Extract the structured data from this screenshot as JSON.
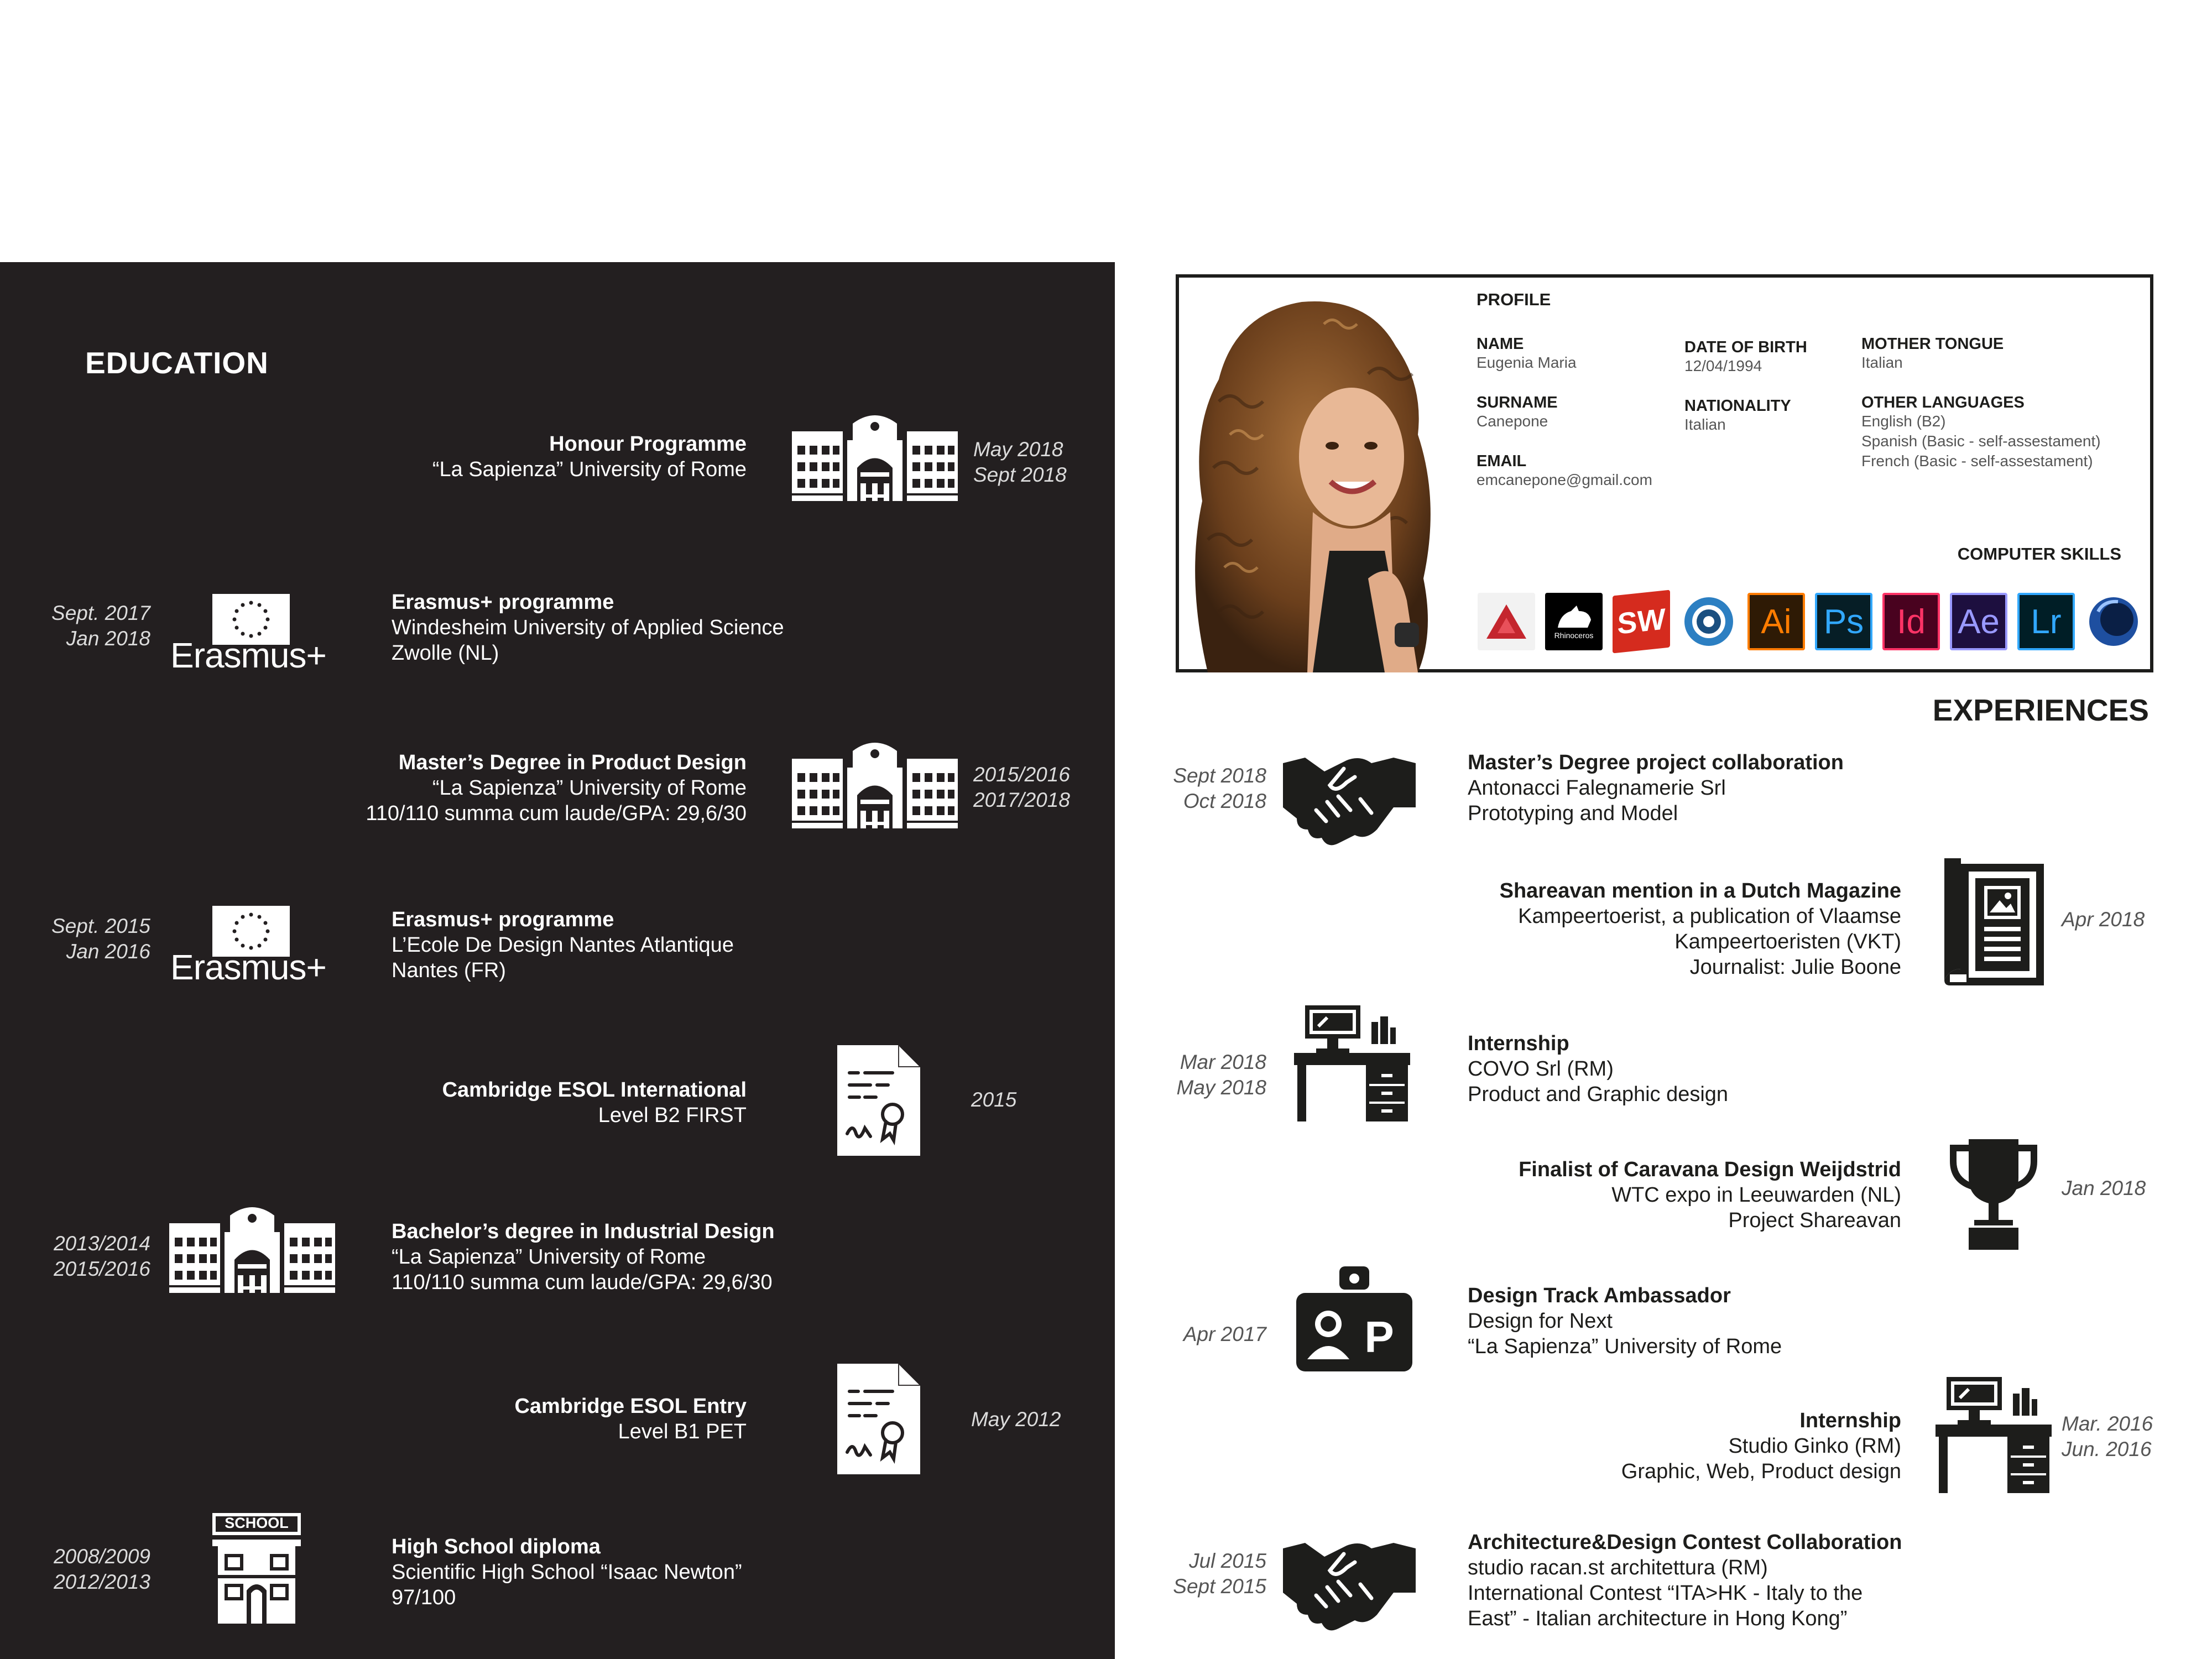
{
  "education": {
    "title": "EDUCATION",
    "items": [
      {
        "title": "Honour Programme",
        "lines": [
          "“La Sapienza” University of Rome"
        ],
        "dates": [
          "May 2018",
          "Sept 2018"
        ]
      },
      {
        "title": "Erasmus+ programme",
        "lines": [
          "Windesheim University of Applied Science",
          "Zwolle (NL)"
        ],
        "dates": [
          "Sept. 2017",
          "Jan 2018"
        ],
        "logo": "Erasmus+"
      },
      {
        "title": "Master’s Degree in Product Design",
        "lines": [
          "“La Sapienza” University of Rome",
          "110/110 summa cum laude/GPA: 29,6/30"
        ],
        "dates": [
          "2015/2016",
          "2017/2018"
        ]
      },
      {
        "title": "Erasmus+ programme",
        "lines": [
          "L’Ecole De Design Nantes Atlantique",
          "Nantes (FR)"
        ],
        "dates": [
          "Sept. 2015",
          "Jan 2016"
        ],
        "logo": "Erasmus+"
      },
      {
        "title": "Cambridge ESOL International",
        "lines": [
          "Level B2 FIRST"
        ],
        "dates": [
          "2015"
        ]
      },
      {
        "title": "Bachelor’s degree in Industrial Design",
        "lines": [
          "“La Sapienza” University of Rome",
          "110/110 summa cum laude/GPA: 29,6/30"
        ],
        "dates": [
          "2013/2014",
          "2015/2016"
        ]
      },
      {
        "title": "Cambridge ESOL Entry",
        "lines": [
          "Level B1 PET"
        ],
        "dates": [
          "May 2012"
        ]
      },
      {
        "title": "High School diploma",
        "lines": [
          "Scientific High School “Isaac Newton”",
          "97/100"
        ],
        "dates": [
          "2008/2009",
          "2012/2013"
        ],
        "sign": "SCHOOL"
      }
    ]
  },
  "profile": {
    "heading": "PROFILE",
    "name_label": "NAME",
    "name": "Eugenia Maria",
    "surname_label": "SURNAME",
    "surname": "Canepone",
    "email_label": "EMAIL",
    "email": "emcanepone@gmail.com",
    "dob_label": "DATE OF BIRTH",
    "dob": "12/04/1994",
    "nationality_label": "NATIONALITY",
    "nationality": "Italian",
    "tongue_label": "MOTHER TONGUE",
    "tongue": "Italian",
    "languages_label": "OTHER LANGUAGES",
    "languages": [
      "English (B2)",
      "Spanish (Basic - self-assestament)",
      "French (Basic - self-assestament)"
    ],
    "skills_label": "COMPUTER SKILLS",
    "skills": [
      {
        "icon": "autocad-icon",
        "text": "",
        "color": "#c4262e"
      },
      {
        "icon": "rhinoceros-icon",
        "text": "Rhinoceros",
        "color": "#000000"
      },
      {
        "icon": "solidworks-icon",
        "text": "SW",
        "color": "#d52b1e"
      },
      {
        "icon": "keyshot-icon",
        "text": "",
        "color": "#2c7fc2"
      },
      {
        "icon": "illustrator-icon",
        "text": "Ai",
        "color": "#ff7c00"
      },
      {
        "icon": "photoshop-icon",
        "text": "Ps",
        "color": "#31a8ff"
      },
      {
        "icon": "indesign-icon",
        "text": "Id",
        "color": "#ff3366"
      },
      {
        "icon": "aftereffects-icon",
        "text": "Ae",
        "color": "#9999ff"
      },
      {
        "icon": "lightroom-icon",
        "text": "Lr",
        "color": "#31a8ff"
      },
      {
        "icon": "cinema4d-icon",
        "text": "",
        "color": "#1e4fa0"
      }
    ]
  },
  "experiences": {
    "title": "EXPERIENCES",
    "items": [
      {
        "title": "Master’s Degree project collaboration",
        "lines": [
          "Antonacci Falegnamerie Srl",
          "Prototyping and Model"
        ],
        "dates": [
          "Sept 2018",
          "Oct 2018"
        ],
        "icon": "handshake-icon"
      },
      {
        "title": "Shareavan mention in a Dutch Magazine",
        "lines": [
          "Kampeertoerist, a publication of Vlaamse",
          "Kampeertoeristen (VKT)",
          "Journalist: Julie Boone"
        ],
        "dates": [
          "Apr 2018"
        ],
        "icon": "magazine-icon"
      },
      {
        "title": "Internship",
        "lines": [
          "COVO Srl (RM)",
          "Product and Graphic design"
        ],
        "dates": [
          "Mar 2018",
          "May 2018"
        ],
        "icon": "desk-icon"
      },
      {
        "title": "Finalist of Caravana Design Weijdstrid",
        "lines": [
          "WTC expo in Leeuwarden (NL)",
          "Project Shareavan"
        ],
        "dates": [
          "Jan 2018"
        ],
        "icon": "trophy-icon"
      },
      {
        "title": "Design Track Ambassador",
        "lines": [
          "Design for Next",
          "“La Sapienza” University of Rome"
        ],
        "dates": [
          "Apr 2017"
        ],
        "icon": "badge-icon"
      },
      {
        "title": "Internship",
        "lines": [
          "Studio Ginko (RM)",
          "Graphic, Web, Product design"
        ],
        "dates": [
          "Mar. 2016",
          "Jun. 2016"
        ],
        "icon": "desk-icon"
      },
      {
        "title": "Architecture&Design Contest Collaboration",
        "lines": [
          "studio racan.st architettura (RM)",
          "International Contest “ITA>HK - Italy to the",
          "East” - Italian architecture in Hong Kong”"
        ],
        "dates": [
          "Jul 2015",
          "Sept 2015"
        ],
        "icon": "handshake-icon"
      }
    ]
  }
}
